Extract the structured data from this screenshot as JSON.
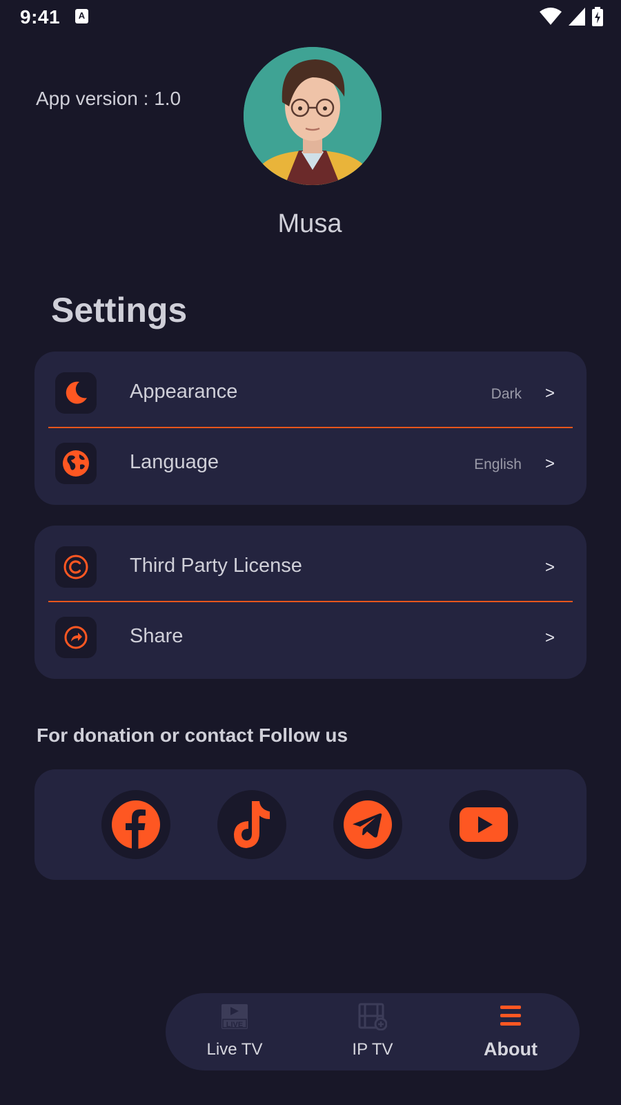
{
  "status_bar": {
    "time": "9:41",
    "notification_icon_letter": "A",
    "icons": [
      "wifi-icon",
      "signal-icon",
      "battery-charging-icon"
    ]
  },
  "profile": {
    "app_version": "App version : 1.0",
    "name": "Musa",
    "avatar": "avatar-image"
  },
  "settings": {
    "title": "Settings",
    "group_1": [
      {
        "label": "Appearance",
        "value": "Dark",
        "chevron": ">",
        "icon": "moon-icon"
      },
      {
        "label": "Language",
        "value": "English",
        "chevron": ">",
        "icon": "globe-icon"
      }
    ],
    "group_2": [
      {
        "label": "Third Party License",
        "chevron": ">",
        "icon": "copyright-icon"
      },
      {
        "label": "Share",
        "chevron": ">",
        "icon": "share-icon"
      }
    ]
  },
  "follow": {
    "title": "For donation or contact Follow us",
    "links": [
      "facebook-icon",
      "tiktok-icon",
      "telegram-icon",
      "youtube-icon"
    ]
  },
  "bottom_nav": {
    "items": [
      {
        "label": "Live TV",
        "icon": "live-tv-icon",
        "active": false
      },
      {
        "label": "IP TV",
        "icon": "film-add-icon",
        "active": false
      },
      {
        "label": "About",
        "icon": "menu-icon",
        "active": true
      }
    ]
  },
  "colors": {
    "background": "#181728",
    "card": "#24243f",
    "accent": "#fe5722",
    "text": "#cfcfd8"
  }
}
